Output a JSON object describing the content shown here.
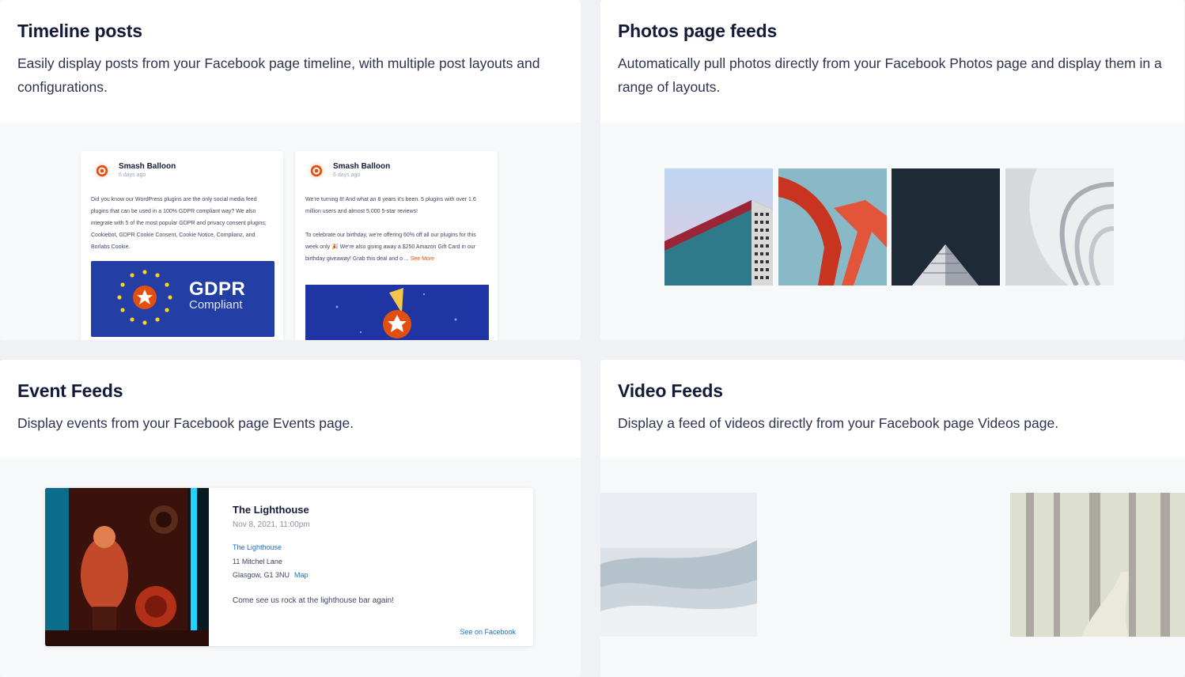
{
  "cards": {
    "timeline": {
      "title": "Timeline posts",
      "description": "Easily display posts from your Facebook page timeline, with multiple post layouts and configurations."
    },
    "photos": {
      "title": "Photos page feeds",
      "description": "Automatically pull photos directly from your Facebook Photos page and display them in a range of layouts."
    },
    "events": {
      "title": "Event Feeds",
      "description": "Display events from your Facebook page Events page."
    },
    "videos": {
      "title": "Video Feeds",
      "description": "Display a feed of videos directly from your Facebook page Videos page."
    }
  },
  "timeline_posts": [
    {
      "author": "Smash Balloon",
      "time": "6 days ago",
      "body": "Did you know our WordPress plugins are the only social media feed plugins that can be used in a 100% GDPR compliant way? We also integrate with 5 of the most popular GDPR and privacy consent plugins; Cookiebot, GDPR Cookie Consent, Cookie Notice, Complianz, and Borlabs Cookie.",
      "image_title": "GDPR",
      "image_subtitle": "Compliant"
    },
    {
      "author": "Smash Balloon",
      "time": "6 days ago",
      "body": "We're turning 8! And what an 8 years it's been. 5 plugins with over 1.6 million users and almost 5,000 5-star reviews!",
      "body2": "To celebrate our birthday, we're offering 60% off all our plugins for this week only 🎉 We're also giving away a $250 Amazon Gift Card in our birthday giveaway! Grab this deal and o ...",
      "see_more": "See More"
    }
  ],
  "event": {
    "title": "The Lighthouse",
    "date": "Nov 8, 2021, 11:00pm",
    "venue": "The Lighthouse",
    "address1": "11 Mitchel Lane",
    "address2": "Glasgow, G1 3NU",
    "map_label": "Map",
    "description": "Come see us rock at the lighthouse bar again!",
    "facebook_link": "See on Facebook"
  },
  "colors": {
    "heading": "#141b38",
    "brand_orange": "#e34f0e",
    "link_blue": "#1e6fbf",
    "gdpr_blue": "#233ea5"
  },
  "icons": [
    "smash-balloon-logo-icon",
    "play-icon"
  ]
}
